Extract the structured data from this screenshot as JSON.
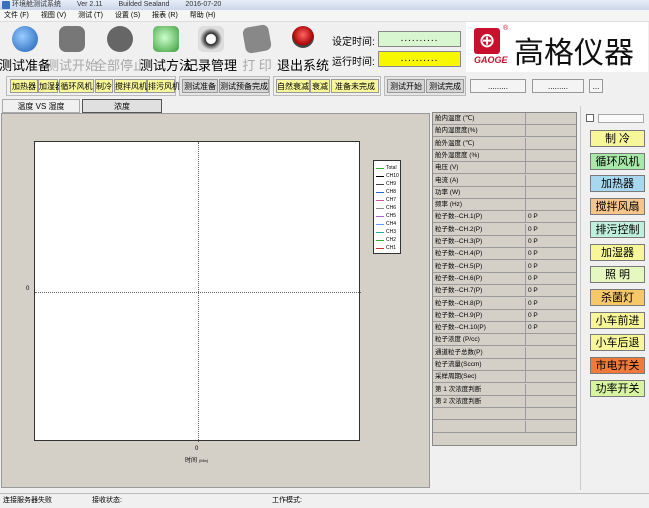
{
  "titlebar": {
    "app": "环境舱测试系统",
    "ver": "Ver 2.11",
    "build": "Builded Sealand",
    "date": "2016-07-20"
  },
  "menu": [
    "文件 (F)",
    "视图 (V)",
    "测试 (T)",
    "设置 (S)",
    "报表 (R)",
    "帮助 (H)"
  ],
  "toolbar": [
    {
      "label": "测试准备",
      "enabled": true
    },
    {
      "label": "测试开始",
      "enabled": false
    },
    {
      "label": "全部停止",
      "enabled": false
    },
    {
      "label": "测试方法",
      "enabled": true
    },
    {
      "label": "记录管理",
      "enabled": true
    },
    {
      "label": "打  印",
      "enabled": false
    },
    {
      "label": "退出系统",
      "enabled": true
    }
  ],
  "time": {
    "set_label": "设定时间:",
    "set_value": "..........",
    "run_label": "运行时间:",
    "run_value": ".........."
  },
  "logo": {
    "sub": "GAOGE",
    "name": "高格仪器"
  },
  "step_buttons": [
    "加热器",
    "加湿器",
    "循环风机",
    "制冷",
    "搅拌风机",
    "排污风机"
  ],
  "prep_buttons": [
    "测试准备",
    "测试预备完成"
  ],
  "decay_buttons": [
    "自然衰减",
    "衰减",
    "准备未完成"
  ],
  "test_buttons": [
    "测试开始",
    "测试完成"
  ],
  "extra_fields": [
    ".........",
    ".........",
    "..."
  ],
  "tabs": [
    "温度 VS 湿度",
    "浓度"
  ],
  "chart_data": {
    "type": "line",
    "x": [
      0
    ],
    "xticks": [
      "0"
    ],
    "yticks": [
      "0"
    ],
    "xlabel": "时间",
    "xunit": "(Min)",
    "grid": true,
    "legend_position": "right",
    "series": [
      {
        "name": "Total",
        "color": "#33aa33",
        "values": []
      },
      {
        "name": "CH10",
        "color": "#000000",
        "values": []
      },
      {
        "name": "CH9",
        "color": "#444444",
        "values": []
      },
      {
        "name": "CH8",
        "color": "#2266cc",
        "values": []
      },
      {
        "name": "CH7",
        "color": "#cc55aa",
        "values": []
      },
      {
        "name": "CH6",
        "color": "#888888",
        "values": []
      },
      {
        "name": "CH5",
        "color": "#aa66cc",
        "values": []
      },
      {
        "name": "CH4",
        "color": "#6699ff",
        "values": []
      },
      {
        "name": "CH3",
        "color": "#22aaaa",
        "values": []
      },
      {
        "name": "CH2",
        "color": "#33aa33",
        "values": []
      },
      {
        "name": "CH1",
        "color": "#cc3333",
        "values": []
      }
    ]
  },
  "table": [
    {
      "k": "舱内温度 (℃)",
      "v": ""
    },
    {
      "k": "舱内湿度度(%)",
      "v": ""
    },
    {
      "k": "舱外温度 (℃)",
      "v": ""
    },
    {
      "k": "舱外湿度度 (%)",
      "v": ""
    },
    {
      "k": "电压 (V)",
      "v": ""
    },
    {
      "k": "电流 (A)",
      "v": ""
    },
    {
      "k": "功率 (W)",
      "v": ""
    },
    {
      "k": "频率 (Hz)",
      "v": ""
    },
    {
      "k": "粒子数--CH.1(P)",
      "v": "0 P"
    },
    {
      "k": "粒子数--CH.2(P)",
      "v": "0 P"
    },
    {
      "k": "粒子数--CH.3(P)",
      "v": "0 P"
    },
    {
      "k": "粒子数--CH.4(P)",
      "v": "0 P"
    },
    {
      "k": "粒子数--CH.5(P)",
      "v": "0 P"
    },
    {
      "k": "粒子数--CH.6(P)",
      "v": "0 P"
    },
    {
      "k": "粒子数--CH.7(P)",
      "v": "0 P"
    },
    {
      "k": "粒子数--CH.8(P)",
      "v": "0 P"
    },
    {
      "k": "粒子数--CH.9(P)",
      "v": "0 P"
    },
    {
      "k": "粒子数--CH.10(P)",
      "v": "0 P"
    },
    {
      "k": "粒子浓度 (P/cc)",
      "v": ""
    },
    {
      "k": "通道粒子总数(P)",
      "v": ""
    },
    {
      "k": "粒子流量(Sccm)",
      "v": ""
    },
    {
      "k": "采样周期(Sec)",
      "v": ""
    },
    {
      "k": "第 1 次浓度判断",
      "v": ""
    },
    {
      "k": "第 2 次浓度判断",
      "v": ""
    },
    {
      "k": "",
      "v": ""
    },
    {
      "k": "",
      "v": ""
    }
  ],
  "controls": [
    {
      "label": "制  冷",
      "color": "#f7f79a"
    },
    {
      "label": "循环风机",
      "color": "#a8e8a8"
    },
    {
      "label": "加热器",
      "color": "#a8d8f0"
    },
    {
      "label": "搅拌风扇",
      "color": "#f7c48a"
    },
    {
      "label": "排污控制",
      "color": "#bff0dd"
    },
    {
      "label": "加湿器",
      "color": "#f7f79a"
    },
    {
      "label": "照  明",
      "color": "#e6f7c0"
    },
    {
      "label": "杀菌灯",
      "color": "#f7c86a"
    },
    {
      "label": "小车前进",
      "color": "#f7f79a"
    },
    {
      "label": "小车后退",
      "color": "#f7f79a"
    },
    {
      "label": "市电开关",
      "color": "#f07a3a"
    },
    {
      "label": "功率开关",
      "color": "#d8f4a0"
    }
  ],
  "status": {
    "conn": "连接服务器失败",
    "recv": "接收状态:",
    "mode": "工作模式:"
  }
}
